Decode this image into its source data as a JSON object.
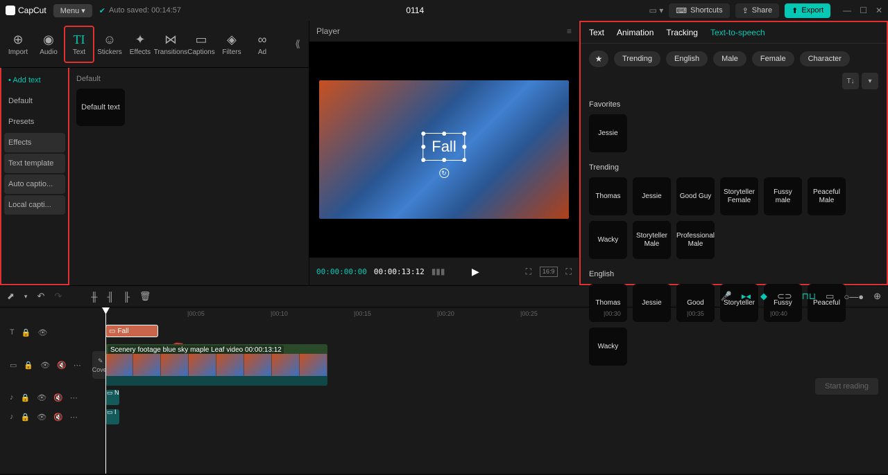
{
  "app": {
    "name": "CapCut",
    "menu": "Menu",
    "autosave": "Auto saved: 00:14:57",
    "project": "0114"
  },
  "titlebar": {
    "shortcuts": "Shortcuts",
    "share": "Share",
    "export": "Export"
  },
  "tools": {
    "import": "Import",
    "audio": "Audio",
    "text": "Text",
    "stickers": "Stickers",
    "effects": "Effects",
    "transitions": "Transitions",
    "captions": "Captions",
    "filters": "Filters",
    "ad": "Ad"
  },
  "sidebar": {
    "items": [
      "Add text",
      "Default",
      "Presets",
      "Effects",
      "Text template",
      "Auto captio...",
      "Local capti..."
    ]
  },
  "content": {
    "section": "Default",
    "thumb": "Default text"
  },
  "player": {
    "title": "Player",
    "overlay": "Fall",
    "cur": "00:00:00:00",
    "dur": "00:00:13:12",
    "ratio": "16:9"
  },
  "right": {
    "tabs": [
      "Text",
      "Animation",
      "Tracking",
      "Text-to-speech"
    ],
    "filters": [
      "Trending",
      "English",
      "Male",
      "Female",
      "Character"
    ],
    "favorites_title": "Favorites",
    "favorites": [
      "Jessie"
    ],
    "trending_title": "Trending",
    "trending": [
      "Thomas",
      "Jessie",
      "Good Guy",
      "Storyteller Female",
      "Fussy male",
      "Peaceful Male",
      "Wacky",
      "Storyteller Male",
      "Professional Male"
    ],
    "english_title": "English",
    "english": [
      "Thomas",
      "Jessie",
      "Good",
      "Storyteller",
      "Fussy",
      "Peaceful",
      "Wacky"
    ],
    "start": "Start reading"
  },
  "timeline": {
    "marks": [
      "|00:05",
      "|00:10",
      "|00:15",
      "|00:20",
      "|00:25",
      "|00:30",
      "|00:35",
      "|00:40"
    ],
    "cover": "Cover",
    "text_clip": "Fall",
    "video_label": "Scenery footage blue sky maple Leaf video   00:00:13:12",
    "audio1": "N",
    "audio2": "I"
  }
}
